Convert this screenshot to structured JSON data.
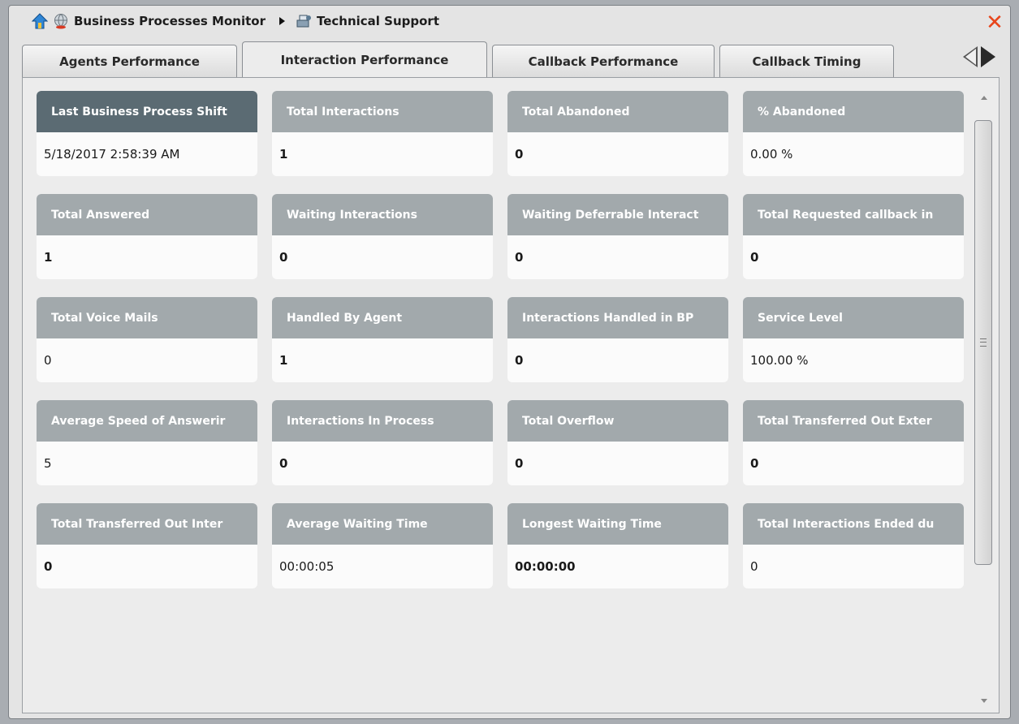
{
  "header": {
    "breadcrumb": [
      "Business Processes Monitor",
      "Technical Support"
    ],
    "icons": [
      "home-icon",
      "globe-icon",
      "support-desk-icon",
      "close-icon"
    ],
    "close_symbol": "✕"
  },
  "tabs": [
    {
      "label": "Agents Performance",
      "active": false
    },
    {
      "label": "Interaction Performance",
      "active": true
    },
    {
      "label": "Callback Performance",
      "active": false
    },
    {
      "label": "Callback Timing",
      "active": false
    }
  ],
  "colors": {
    "card_header": "#a2a9ac",
    "card_header_selected": "#5b6b73",
    "close": "#e8451b"
  },
  "cards": [
    {
      "title": "Last Business Process Shift",
      "value": "5/18/2017 2:58:39 AM"
    },
    {
      "title": "Total Interactions",
      "value": "1"
    },
    {
      "title": "Total Abandoned",
      "value": "0"
    },
    {
      "title": "% Abandoned",
      "value": "0.00 %"
    },
    {
      "title": "Total Answered",
      "value": "1"
    },
    {
      "title": "Waiting Interactions",
      "value": "0"
    },
    {
      "title": "Waiting Deferrable Interact",
      "value": "0"
    },
    {
      "title": "Total Requested callback in",
      "value": "0"
    },
    {
      "title": "Total Voice Mails",
      "value": "0"
    },
    {
      "title": "Handled By Agent",
      "value": "1"
    },
    {
      "title": "Interactions Handled in BP",
      "value": "0"
    },
    {
      "title": "Service Level",
      "value": "100.00 %"
    },
    {
      "title": "Average Speed of Answerir",
      "value": "5"
    },
    {
      "title": "Interactions In Process",
      "value": "0"
    },
    {
      "title": "Total Overflow",
      "value": "0"
    },
    {
      "title": "Total Transferred Out Exter",
      "value": "0"
    },
    {
      "title": "Total Transferred Out Inter",
      "value": "0"
    },
    {
      "title": "Average Waiting Time",
      "value": "00:00:05"
    },
    {
      "title": "Longest Waiting Time",
      "value": "00:00:00"
    },
    {
      "title": "Total Interactions Ended du",
      "value": "0"
    }
  ]
}
